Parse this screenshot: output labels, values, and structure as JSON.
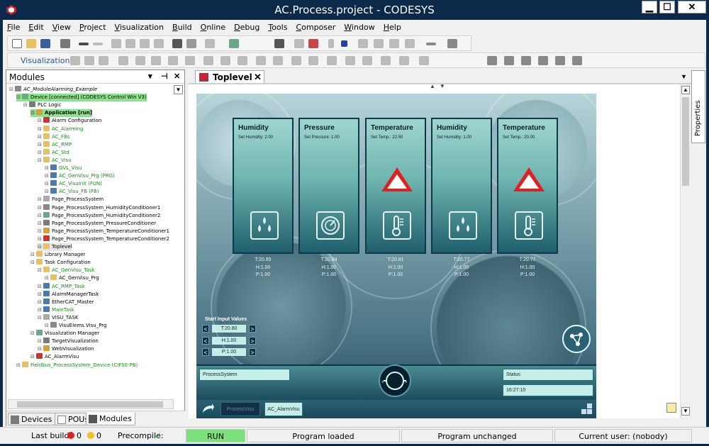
{
  "window": {
    "title": "AC.Process.project - CODESYS",
    "min": "▁",
    "max": "☐",
    "close": "✕"
  },
  "menu": [
    "File",
    "Edit",
    "View",
    "Project",
    "Visualization",
    "Build",
    "Online",
    "Debug",
    "Tools",
    "Composer",
    "Window",
    "Help"
  ],
  "toolbar2": {
    "label": "Visualization"
  },
  "modules_panel": {
    "title": "Modules",
    "tree": [
      {
        "label": "AC_ModuleAlarming_Example",
        "indent": 0,
        "style": "italic"
      },
      {
        "label": "Device [connected] (CODESYS Control Win V3)",
        "indent": 1,
        "style": "green-bg"
      },
      {
        "label": "PLC Logic",
        "indent": 2
      },
      {
        "label": "Application [run]",
        "indent": 3,
        "style": "green-bg bold"
      },
      {
        "label": "Alarm Configuration",
        "indent": 4
      },
      {
        "label": "AC_Alarming",
        "indent": 4,
        "style": "green"
      },
      {
        "label": "AC_FBs",
        "indent": 4,
        "style": "green"
      },
      {
        "label": "AC_RMP",
        "indent": 4,
        "style": "green"
      },
      {
        "label": "AC_Std",
        "indent": 4,
        "style": "green"
      },
      {
        "label": "AC_Visu",
        "indent": 4,
        "style": "green"
      },
      {
        "label": "GVL_Visu",
        "indent": 5,
        "style": "green"
      },
      {
        "label": "AC_GenVisu_Prg (PRG)",
        "indent": 5,
        "style": "green"
      },
      {
        "label": "AC_VisuInit (FUN)",
        "indent": 5,
        "style": "green"
      },
      {
        "label": "AC_Visu_FB (FB)",
        "indent": 5,
        "style": "green"
      },
      {
        "label": "Page_ProcessSystem",
        "indent": 4
      },
      {
        "label": "Page_ProcessSystem_HumidityConditioner1",
        "indent": 4
      },
      {
        "label": "Page_ProcessSystem_HumidityConditioner2",
        "indent": 4
      },
      {
        "label": "Page_ProcessSystem_PressureConditioner",
        "indent": 4
      },
      {
        "label": "Page_ProcessSystem_TemperatureConditioner1",
        "indent": 4
      },
      {
        "label": "Page_ProcessSystem_TemperatureConditioner2",
        "indent": 4
      },
      {
        "label": "Toplevel",
        "indent": 4,
        "style": "sel"
      },
      {
        "label": "Library Manager",
        "indent": 3
      },
      {
        "label": "Task Configuration",
        "indent": 3
      },
      {
        "label": "AC_GenVisu_Task",
        "indent": 4,
        "style": "green"
      },
      {
        "label": "AC_GenVisu_Prg",
        "indent": 5
      },
      {
        "label": "AC_RMP_Task",
        "indent": 4,
        "style": "green"
      },
      {
        "label": "AlarmManagerTask",
        "indent": 4
      },
      {
        "label": "EtherCAT_Master",
        "indent": 4
      },
      {
        "label": "MainTask",
        "indent": 4,
        "style": "green"
      },
      {
        "label": "VISU_TASK",
        "indent": 4
      },
      {
        "label": "VisuElems.Visu_Prg",
        "indent": 5
      },
      {
        "label": "Visualization Manager",
        "indent": 3
      },
      {
        "label": "TargetVisualization",
        "indent": 4
      },
      {
        "label": "WebVisualization",
        "indent": 4
      },
      {
        "label": "AC_AlarmVisu",
        "indent": 3
      },
      {
        "label": "Fieldbus_ProcessSystem_Device (CIFS0-PB)",
        "indent": 1,
        "style": "green"
      }
    ],
    "tabs": [
      {
        "label": "Devices",
        "icon": "devices-icon"
      },
      {
        "label": "POUs",
        "icon": "pous-icon"
      },
      {
        "label": "Modules",
        "icon": "modules-icon"
      }
    ]
  },
  "editor_tab": {
    "label": "Toplevel",
    "close": "✕"
  },
  "properties_tab": "Properties",
  "visu": {
    "cards": [
      {
        "title": "Humidity",
        "setpoint": "Set Humidity: 2.00",
        "alarm": false,
        "symbol": "drops-icon",
        "t": "T:20.85",
        "h": "H:1.00",
        "p": "P:1.00"
      },
      {
        "title": "Pressure",
        "setpoint": "Set Pressure: 1.00",
        "alarm": false,
        "symbol": "gauge-icon",
        "t": "T:20.84",
        "h": "H:1.00",
        "p": "P:1.00"
      },
      {
        "title": "Temperature",
        "setpoint": "Set Temp.: 22.50",
        "alarm": true,
        "symbol": "thermometer-icon",
        "t": "T:20.81",
        "h": "H:1.00",
        "p": "P:1.00"
      },
      {
        "title": "Humidity",
        "setpoint": "Set Humidity: 1.00",
        "alarm": false,
        "symbol": "drops-icon",
        "t": "T:20.77",
        "h": "H:1.00",
        "p": "P:1.00"
      },
      {
        "title": "Temperature",
        "setpoint": "Set Temp.: 20.00",
        "alarm": true,
        "symbol": "thermometer-icon",
        "t": "T:20.77",
        "h": "H:1.00",
        "p": "P:1.00"
      }
    ],
    "start_input": {
      "title": "Start Input Values",
      "rows": [
        {
          "value": "T:20.80"
        },
        {
          "value": "H:1.00"
        },
        {
          "value": "P:1.00"
        }
      ]
    },
    "bottom": {
      "process_label": "ProcessSystem",
      "status_label": "Status",
      "time": "16:27:10"
    },
    "nav": {
      "left": "ProcessVisu",
      "right": "AC_AlarmVisu"
    }
  },
  "status": {
    "last_build_label": "Last build:",
    "errors": "0",
    "warnings": "0",
    "precompile_label": "Precompile:",
    "run": "RUN",
    "program_loaded": "Program loaded",
    "program_unchanged": "Program unchanged",
    "current_user": "Current user: (nobody)"
  },
  "colors": {
    "accent_green": "#8de08d",
    "alarm_red": "#e02020",
    "title_bar": "#0b2a4a"
  }
}
